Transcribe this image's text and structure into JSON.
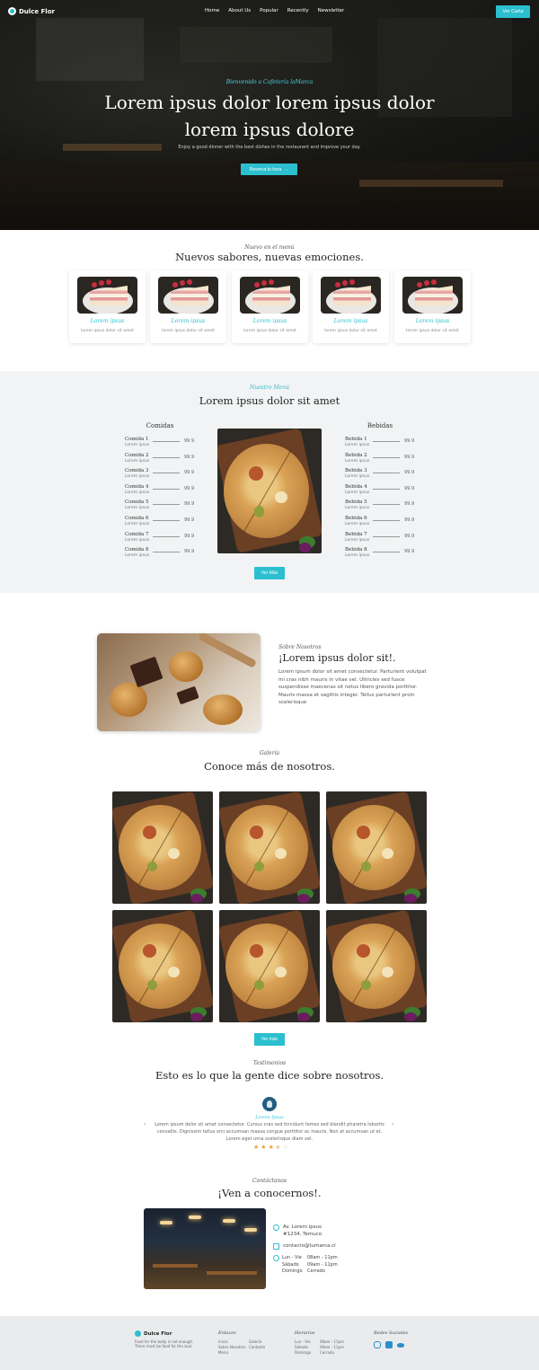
{
  "nav": {
    "logo": "Dulce Flor",
    "links": [
      "Home",
      "About Us",
      "Popular",
      "Recently",
      "Newsletter"
    ],
    "cta": "Ver Carta"
  },
  "hero": {
    "subtitle": "Bienvenido a Cafetería laMarca",
    "title": "Lorem ipsus dolor lorem ipsus dolor lorem ipsus dolore",
    "description": "Enjoy a good dinner with the best dishes in the restaurant and improve your day.",
    "button": "Reserva tu hora",
    "button_arrow": "→"
  },
  "news": {
    "subtitle": "Nuevo en el menú",
    "title": "Nuevos sabores, nuevas emociones.",
    "cards": [
      {
        "title": "Lorem ipsus",
        "desc": "lorem ipsus dolor sit amet"
      },
      {
        "title": "Lorem ipsus",
        "desc": "lorem ipsus dolor sit amet"
      },
      {
        "title": "Lorem ipsus",
        "desc": "lorem ipsus dolor sit amet"
      },
      {
        "title": "Lorem ipsus",
        "desc": "lorem ipsus dolor sit amet"
      },
      {
        "title": "Lorem ipsus",
        "desc": "lorem ipsus dolor sit amet"
      }
    ]
  },
  "menu": {
    "subtitle": "Nuestro Menú",
    "title": "Lorem ipsus dolor sit amet",
    "left_head": "Comidas",
    "right_head": "Bebidas",
    "food": [
      {
        "name": "Comida 1",
        "desc": "Lorem ipsus",
        "price": "99.9"
      },
      {
        "name": "Comida 2",
        "desc": "Lorem ipsus",
        "price": "99.9"
      },
      {
        "name": "Comida 3",
        "desc": "Lorem ipsus",
        "price": "99.9"
      },
      {
        "name": "Comida 4",
        "desc": "Lorem ipsus",
        "price": "99.9"
      },
      {
        "name": "Comida 5",
        "desc": "Lorem ipsus",
        "price": "99.9"
      },
      {
        "name": "Comida 6",
        "desc": "Lorem ipsus",
        "price": "99.9"
      },
      {
        "name": "Comida 7",
        "desc": "Lorem ipsus",
        "price": "99.9"
      },
      {
        "name": "Comida 8",
        "desc": "Lorem ipsus",
        "price": "99.9"
      }
    ],
    "drinks": [
      {
        "name": "Bebida 1",
        "desc": "Lorem ipsus",
        "price": "99.9"
      },
      {
        "name": "Bebida 2",
        "desc": "Lorem ipsus",
        "price": "99.9"
      },
      {
        "name": "Bebida 3",
        "desc": "Lorem ipsus",
        "price": "99.9"
      },
      {
        "name": "Bebida 4",
        "desc": "Lorem ipsus",
        "price": "99.9"
      },
      {
        "name": "Bebida 5",
        "desc": "Lorem ipsus",
        "price": "99.9"
      },
      {
        "name": "Bebida 6",
        "desc": "Lorem ipsus",
        "price": "99.9"
      },
      {
        "name": "Bebida 7",
        "desc": "Lorem ipsus",
        "price": "99.9"
      },
      {
        "name": "Bebida 8",
        "desc": "Lorem ipsus",
        "price": "99.9"
      }
    ],
    "button": "Ver Más"
  },
  "about": {
    "subtitle": "Sobre Nosotros",
    "title": "¡Lorem ipsus dolor sit!.",
    "text": "Lorem ipsum dolor sit amet consectetur. Parturient volutpat mi cras nibh mauris in vitae vel. Ultricies sed fusce suspendisse maecenas sit netus libero gravida porttitor. Mauris massa et sagittis integer. Tellus parturient proin scelerisque"
  },
  "gallery": {
    "subtitle": "Galería",
    "title": "Conoce más de nosotros.",
    "button": "Ver más"
  },
  "testimonials": {
    "subtitle": "Testimonios",
    "title": "Esto es lo que la gente dice sobre nosotros.",
    "name": "Lorem Ipsus",
    "text": "Lorem ipsum dolor sit amet consectetur. Cursus cras sed tincidunt fames sed blandit pharetra lobortis convallis. Dignissim tellus orci accumsan massa congue porttitor ac mauris. Non at accumsan ut et. Lorem eget urna scelerisque diam vel.",
    "prev": "‹",
    "next": "›",
    "rating": 3.5
  },
  "contact": {
    "subtitle": "Contáctanos",
    "title": "¡Ven a conocernos!.",
    "address": "Av. Lorem ipsus #1234, Temuco",
    "email": "contacto@tumarca.cl",
    "hours": [
      {
        "day": "Lun - Vie",
        "time": "08am - 11pm"
      },
      {
        "day": "Sábado",
        "time": "09am - 11pm"
      },
      {
        "day": "Domingo",
        "time": "Cerrado"
      }
    ]
  },
  "footer": {
    "logo": "Dulce Flor",
    "tagline": "Food for the body is not enough. There must be food for the soul.",
    "links_head": "Enlaces",
    "links_col1": [
      "Inicio",
      "Sobre Nosotros",
      "Menú"
    ],
    "links_col2": [
      "Galería",
      "Contacto"
    ],
    "hours_head": "Horarios",
    "hours": [
      {
        "day": "Lun - Vie",
        "time": "08am - 11pm"
      },
      {
        "day": "Sábado",
        "time": "09am - 11pm"
      },
      {
        "day": "Domingo",
        "time": "Cerrado"
      }
    ],
    "social_head": "Redes Sociales",
    "social": [
      "instagram-icon",
      "facebook-icon",
      "twitter-icon"
    ]
  },
  "colors": {
    "accent": "#2bbfcf",
    "star": "#e9a23b"
  }
}
